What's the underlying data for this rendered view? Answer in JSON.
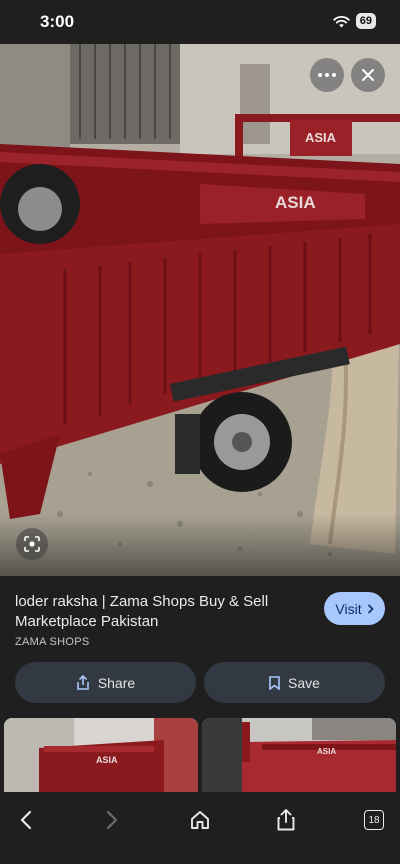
{
  "status_bar": {
    "time": "3:00",
    "battery": "69"
  },
  "image": {
    "truck_label": "ASIA",
    "cab_label": "ASIA"
  },
  "result": {
    "title": "loder raksha | Zama Shops Buy & Sell Marketplace Pakistan",
    "source": "ZAMA SHOPS",
    "visit_label": "Visit"
  },
  "actions": {
    "share_label": "Share",
    "save_label": "Save"
  },
  "thumbnails": {
    "thumb1_label": "ASIA",
    "thumb2_label": "ASIA"
  },
  "toolbar": {
    "tab_count": "18"
  },
  "colors": {
    "truck_red": "#8b1a1f",
    "accent": "#a8c7fa",
    "background": "#1f1f1f"
  }
}
